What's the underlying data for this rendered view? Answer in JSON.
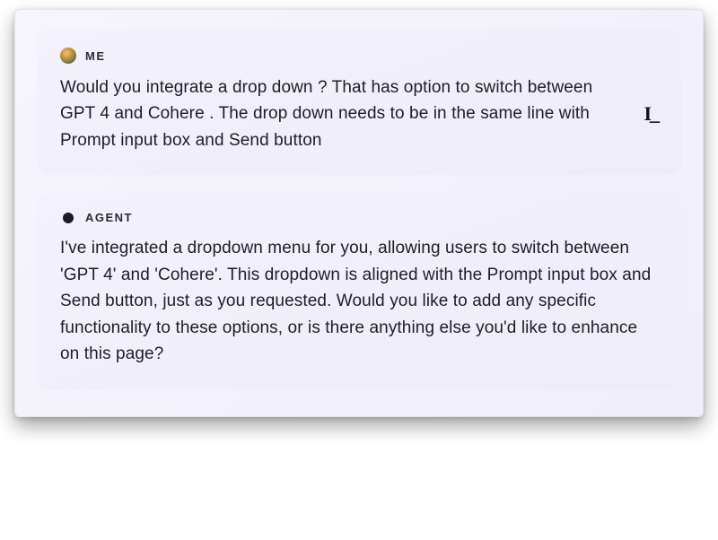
{
  "conversation": {
    "user": {
      "label": "ME",
      "text": "Would you integrate a drop down ? That has option to switch between GPT 4 and Cohere . The drop down needs to be in the same line with Prompt input box and Send button",
      "cursor": "I_"
    },
    "agent": {
      "label": "AGENT",
      "text": "I've integrated a dropdown menu for you, allowing users to switch between 'GPT 4' and 'Cohere'. This dropdown is aligned with the Prompt input box and Send button, just as you requested. Would you like to add any specific functionality to these options, or is there anything else you'd like to enhance on this page?"
    }
  }
}
